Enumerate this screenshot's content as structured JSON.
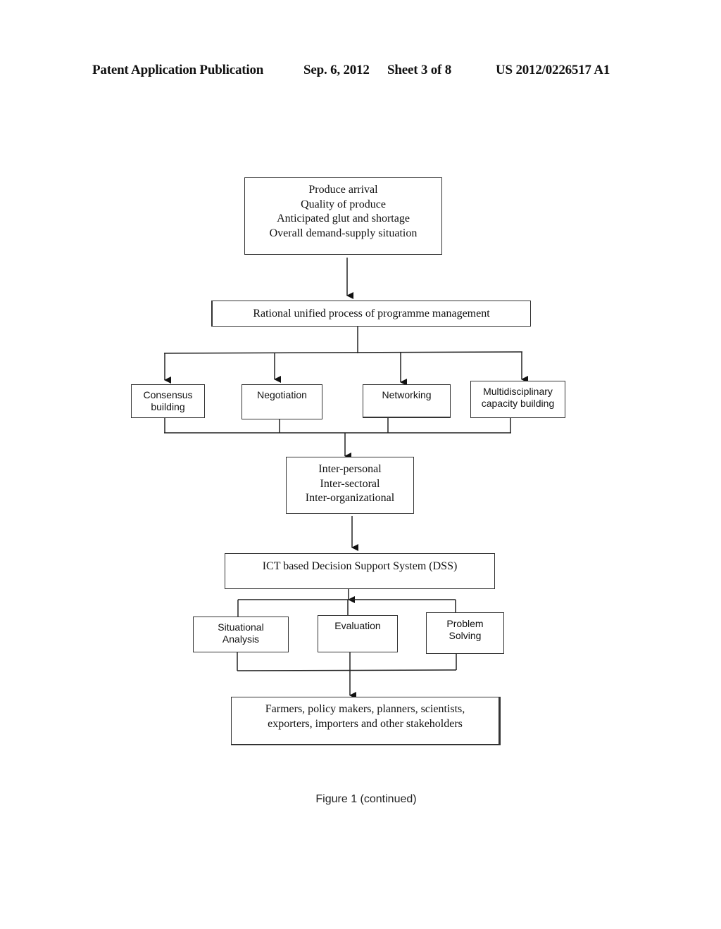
{
  "header": {
    "publication": "Patent Application Publication",
    "date": "Sep. 6, 2012",
    "sheet": "Sheet 3 of 8",
    "number": "US 2012/0226517 A1"
  },
  "diagram": {
    "inputs_box": {
      "lines": [
        "Produce arrival",
        "Quality of produce",
        "Anticipated glut and shortage",
        "Overall demand-supply situation"
      ]
    },
    "process_box": {
      "label": "Rational unified process of programme management"
    },
    "activities": [
      {
        "lines": [
          "Consensus",
          "building"
        ]
      },
      {
        "lines": [
          "Negotiation"
        ]
      },
      {
        "lines": [
          "Networking"
        ]
      },
      {
        "lines": [
          "Multidisciplinary",
          "capacity building"
        ]
      }
    ],
    "levels_box": {
      "lines": [
        "Inter-personal",
        "Inter-sectoral",
        "Inter-organizational"
      ]
    },
    "dss_box": {
      "label": "ICT based Decision Support System (DSS)"
    },
    "dss_functions": [
      {
        "lines": [
          "Situational",
          "Analysis"
        ]
      },
      {
        "lines": [
          "Evaluation"
        ]
      },
      {
        "lines": [
          "Problem",
          "Solving"
        ]
      }
    ],
    "stakeholders_box": {
      "lines": [
        "Farmers, policy makers, planners, scientists,",
        "exporters, importers and other stakeholders"
      ]
    }
  },
  "caption": "Figure 1 (continued)"
}
